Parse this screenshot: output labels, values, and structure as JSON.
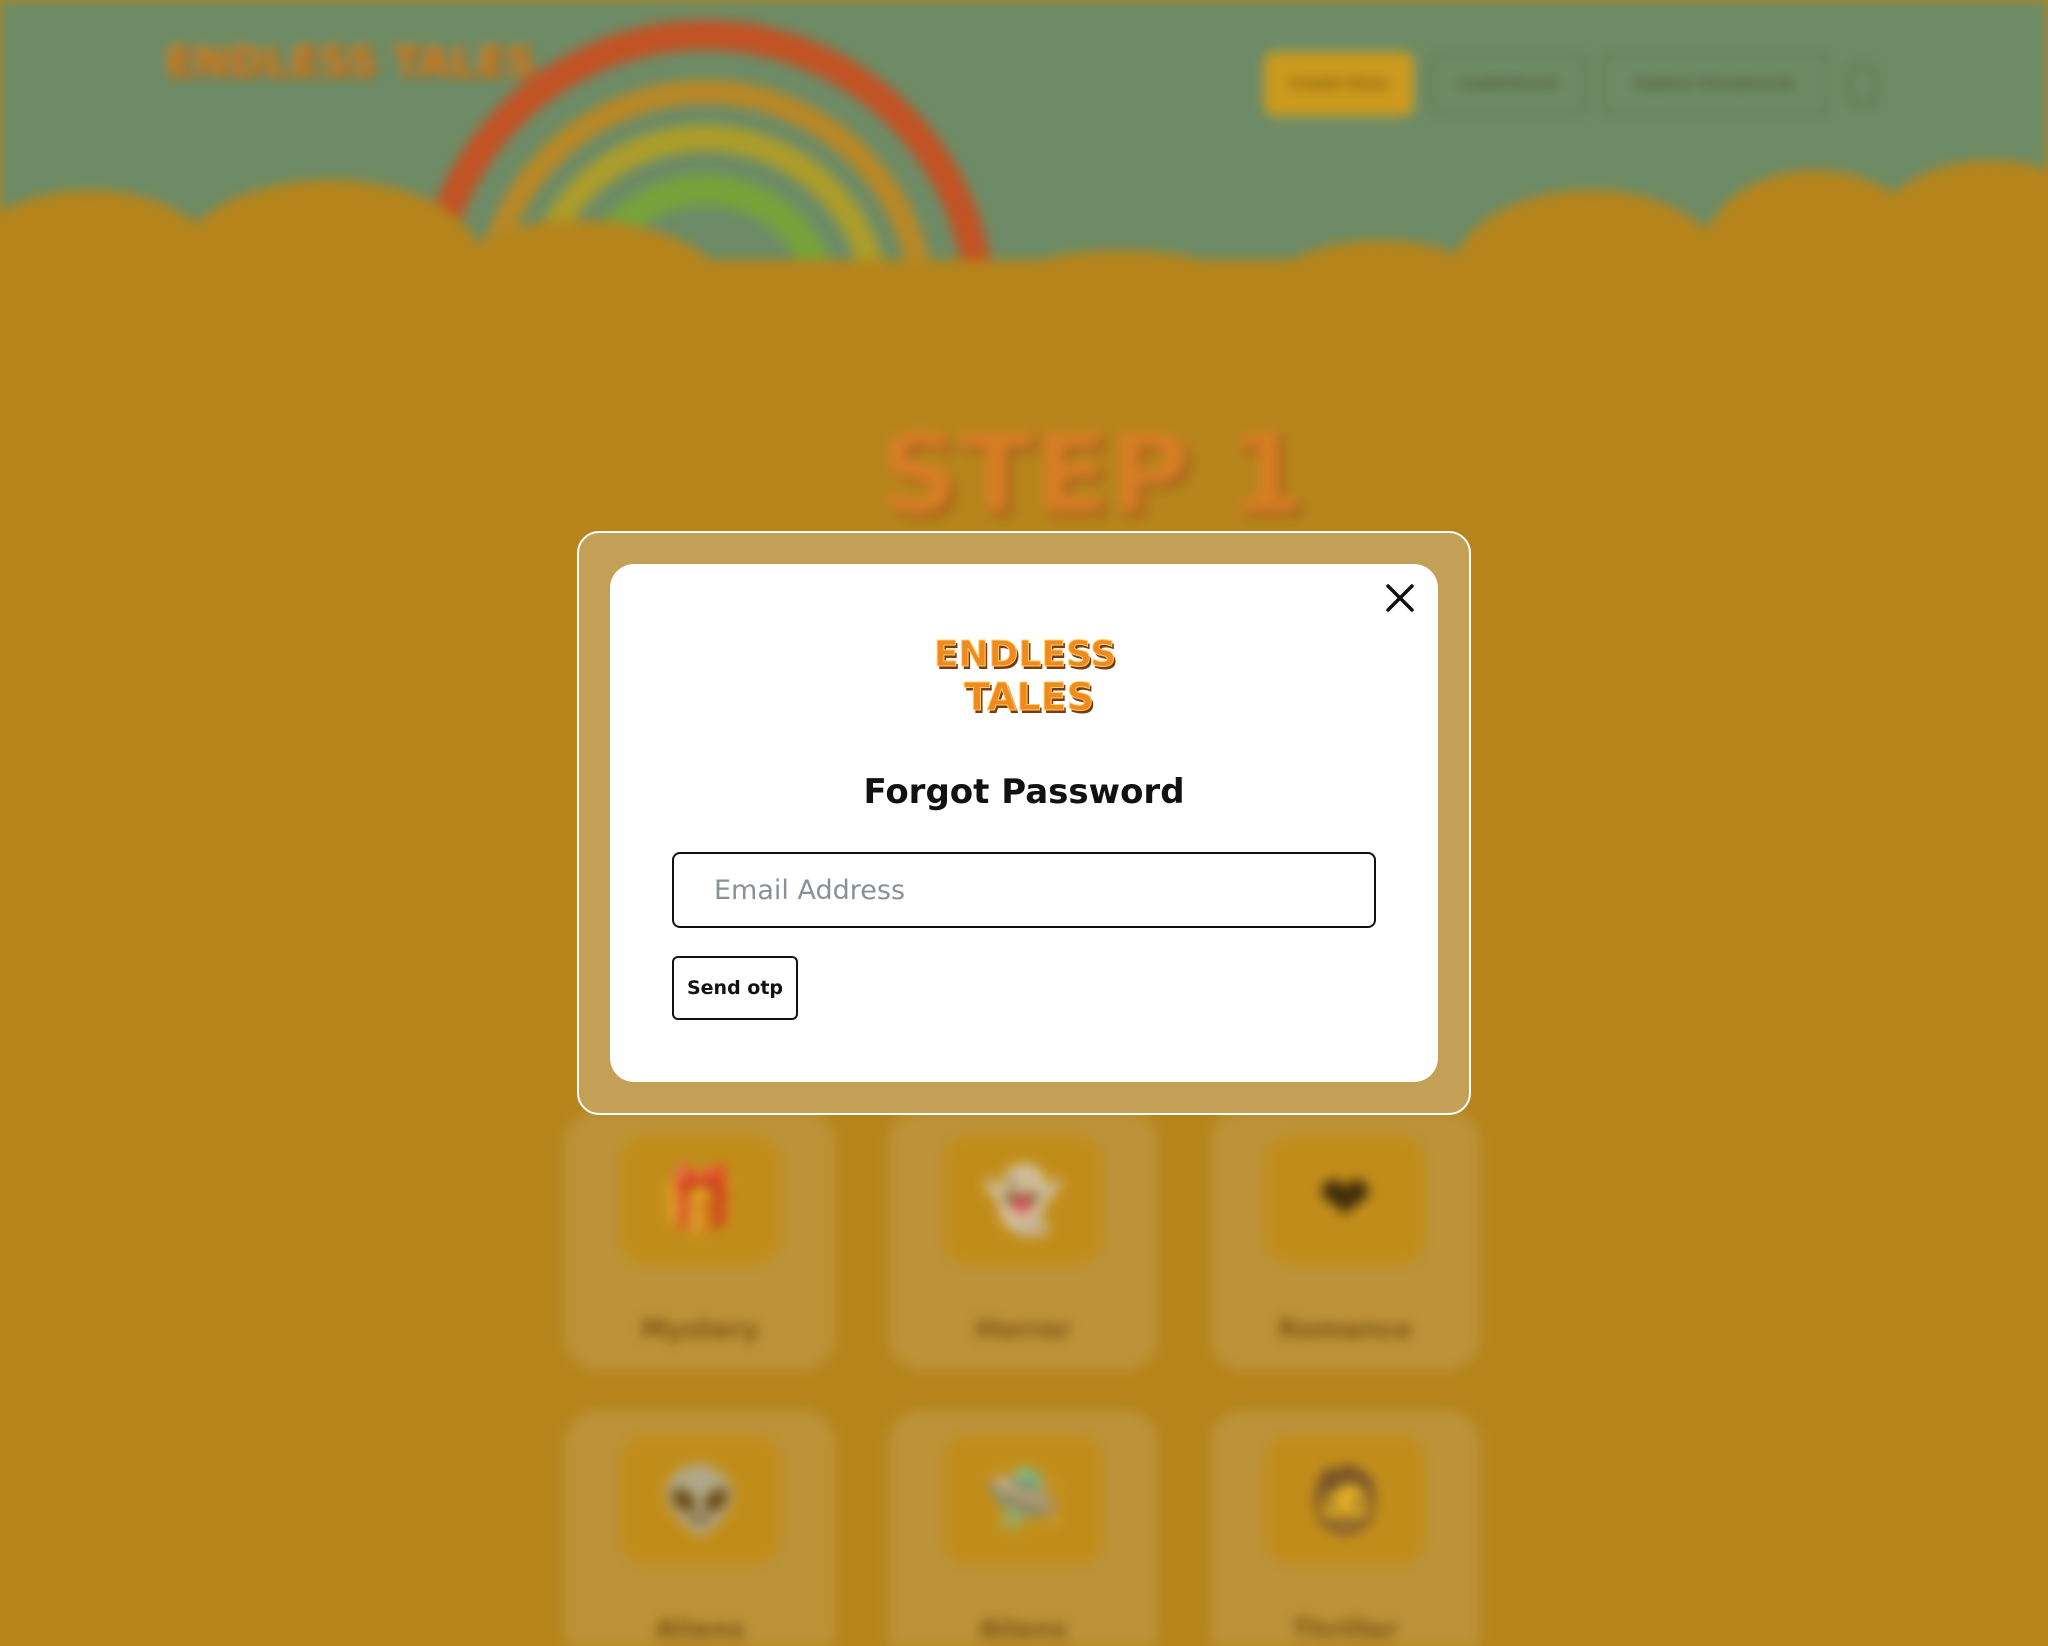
{
  "background": {
    "logo_text": "ENDLESS TALES",
    "nav": [
      {
        "label": "Create Story"
      },
      {
        "label": "Leaderboard"
      },
      {
        "label": "Explore Storyboards"
      }
    ],
    "heading": "STEP 1",
    "categories": [
      {
        "label": "Mystery",
        "icon": "gift-box-icon"
      },
      {
        "label": "Horror",
        "icon": "ghost-icon"
      },
      {
        "label": "Romance",
        "icon": "heart-icon"
      },
      {
        "label": "Aliens",
        "icon": "alien-icon"
      },
      {
        "label": "Aliens",
        "icon": "ufo-icon"
      },
      {
        "label": "Thriller",
        "icon": "person-icon"
      }
    ]
  },
  "modal": {
    "logo_text_line1": "ENDLESS",
    "logo_text_line2": "TALES",
    "title": "Forgot Password",
    "email_placeholder": "Email Address",
    "email_value": "",
    "send_label": "Send otp",
    "close_icon": "close-icon"
  },
  "colors": {
    "page_bg": "#b5851b",
    "sky": "#45908e",
    "modal_frame": "#c3a055",
    "logo_orange": "#f08a1e"
  }
}
